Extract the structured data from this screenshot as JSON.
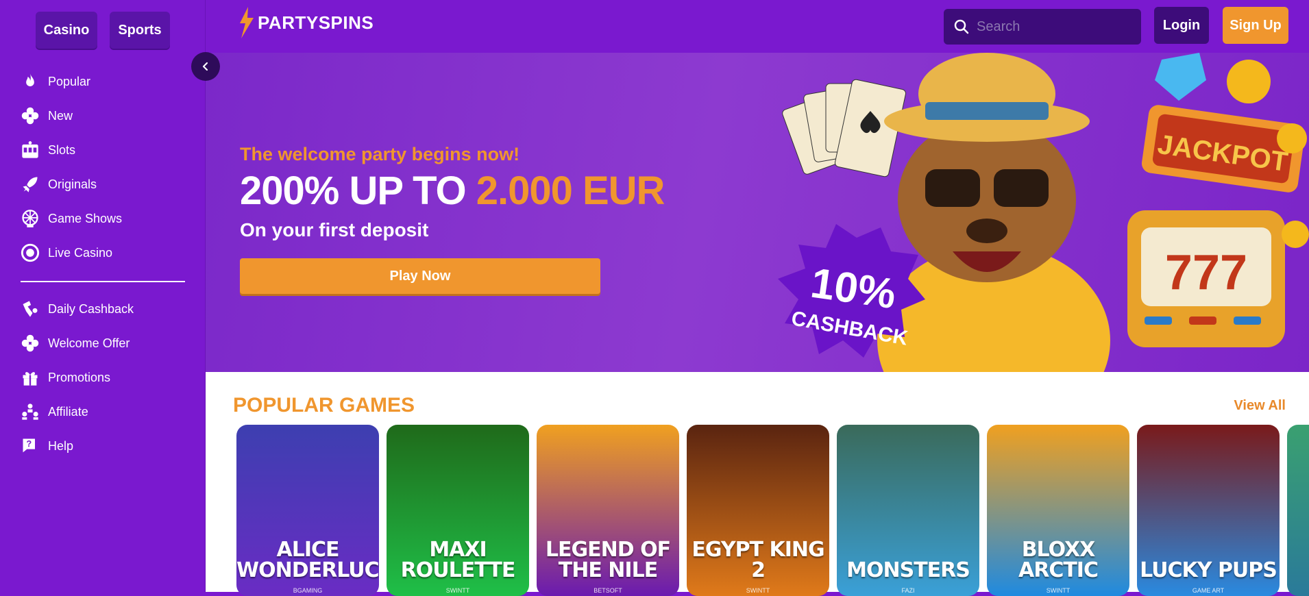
{
  "sidebar": {
    "casino_label": "Casino",
    "sports_label": "Sports",
    "items": [
      {
        "label": "Popular",
        "icon": "flame-icon"
      },
      {
        "label": "New",
        "icon": "clover-icon"
      },
      {
        "label": "Slots",
        "icon": "slot-machine-icon"
      },
      {
        "label": "Originals",
        "icon": "rocket-icon"
      },
      {
        "label": "Game Shows",
        "icon": "wheel-icon"
      },
      {
        "label": "Live Casino",
        "icon": "chip-icon"
      }
    ],
    "items2": [
      {
        "label": "Daily Cashback",
        "icon": "cashback-icon"
      },
      {
        "label": "Welcome Offer",
        "icon": "clover-icon"
      },
      {
        "label": "Promotions",
        "icon": "gift-icon"
      },
      {
        "label": "Affiliate",
        "icon": "affiliate-icon"
      },
      {
        "label": "Help",
        "icon": "help-icon"
      }
    ]
  },
  "header": {
    "logo_text": "PARTYSPINS",
    "search_placeholder": "Search",
    "login_label": "Login",
    "signup_label": "Sign Up"
  },
  "hero": {
    "subtitle": "The welcome party begins now!",
    "title_prefix": "200% UP TO ",
    "title_amount": "2.000 EUR",
    "first_deposit": "On your first deposit",
    "play_label": "Play Now",
    "badge_percent": "10%",
    "badge_text": "CASHBACK",
    "jackpot_text": "JACKPOT",
    "slot_digits": "777"
  },
  "popular": {
    "heading": "POPULAR GAMES",
    "view_all": "View All",
    "games": [
      {
        "title": "ALICE WONDERLUCK",
        "provider": "BGAMING",
        "color_top": "#3d3fb0",
        "color_bottom": "#6a2cc4"
      },
      {
        "title": "MAXI ROULETTE",
        "provider": "SWINTT",
        "color_top": "#1f6a1a",
        "color_bottom": "#1fbf48"
      },
      {
        "title": "LEGEND OF THE NILE",
        "provider": "BETSOFT",
        "color_top": "#f0a020",
        "color_bottom": "#6a1ab0"
      },
      {
        "title": "EGYPT KING 2",
        "provider": "SWINTT",
        "color_top": "#5a2410",
        "color_bottom": "#e07a1a"
      },
      {
        "title": "MONSTERS",
        "provider": "FAZI",
        "color_top": "#3a6a5a",
        "color_bottom": "#3aa0d8"
      },
      {
        "title": "BLOXX ARCTIC",
        "provider": "SWINTT",
        "color_top": "#f0a020",
        "color_bottom": "#1f8ae0"
      },
      {
        "title": "LUCKY PUPS",
        "provider": "GAME ART",
        "color_top": "#7a1a1a",
        "color_bottom": "#2a8ae0"
      }
    ]
  }
}
